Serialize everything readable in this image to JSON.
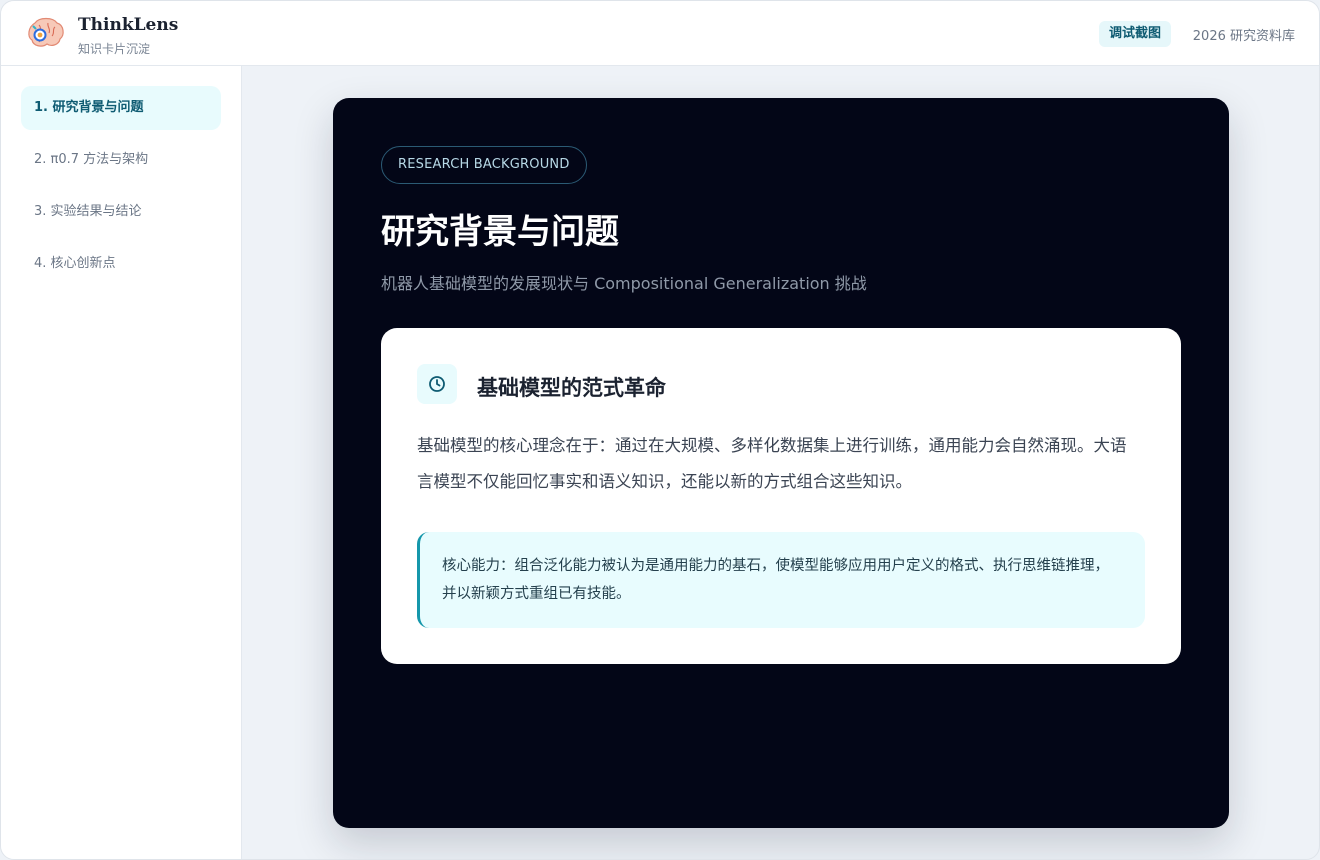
{
  "header": {
    "brand_name": "ThinkLens",
    "brand_sub": "知识卡片沉淀",
    "debug_badge": "调试截图",
    "right_text": "2026 研究资料库"
  },
  "sidebar": {
    "items": [
      {
        "label": "1. 研究背景与问题",
        "active": true
      },
      {
        "label": "2. π0.7 方法与架构",
        "active": false
      },
      {
        "label": "3. 实验结果与结论",
        "active": false
      },
      {
        "label": "4. 核心创新点",
        "active": false
      }
    ]
  },
  "slide": {
    "tag": "RESEARCH BACKGROUND",
    "title": "研究背景与问题",
    "subtitle": "机器人基础模型的发展现状与 Compositional Generalization 挑战",
    "card": {
      "icon": "clock-icon",
      "title": "基础模型的范式革命",
      "body": "基础模型的核心理念在于：通过在大规模、多样化数据集上进行训练，通用能力会自然涌现。大语言模型不仅能回忆事实和语义知识，还能以新的方式组合这些知识。",
      "callout": "核心能力：组合泛化能力被认为是通用能力的基石，使模型能够应用用户定义的格式、执行思维链推理，并以新颖方式重组已有技能。"
    }
  },
  "colors": {
    "accent": "#1597ab",
    "slide_bg": "#030617",
    "active_nav_bg": "#e8fbfd"
  }
}
